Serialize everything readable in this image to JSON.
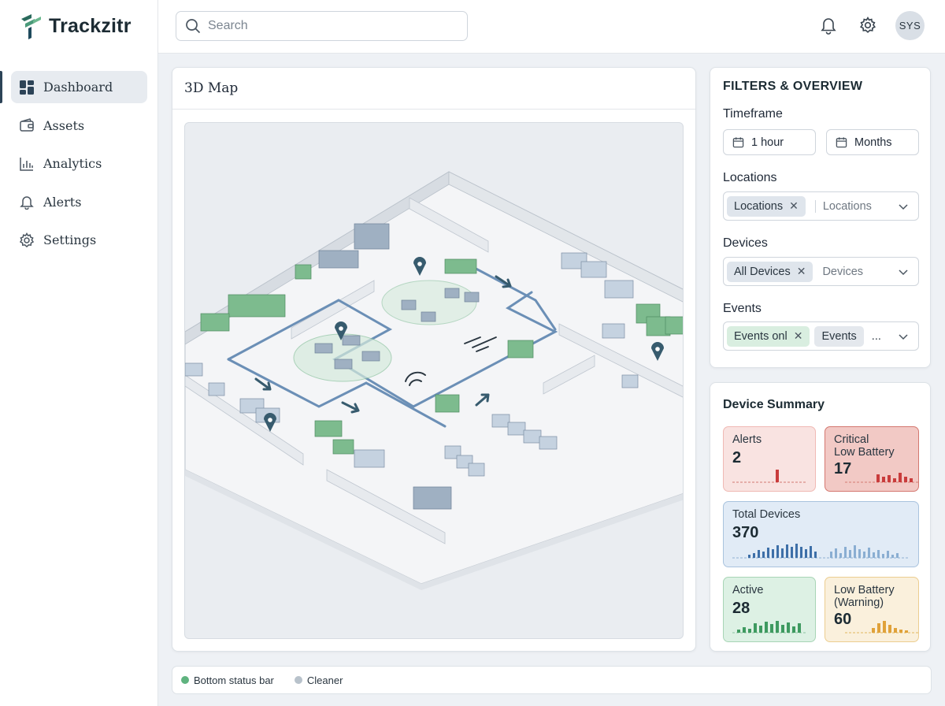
{
  "app": {
    "name": "Trackzitr"
  },
  "sidebar": {
    "items": [
      {
        "label": "Dashboard",
        "icon": "dashboard-icon",
        "active": true
      },
      {
        "label": "Assets",
        "icon": "wallet-icon",
        "active": false
      },
      {
        "label": "Analytics",
        "icon": "bar-chart-icon",
        "active": false
      },
      {
        "label": "Alerts",
        "icon": "bell-icon",
        "active": false
      },
      {
        "label": "Settings",
        "icon": "gear-icon",
        "active": false
      }
    ]
  },
  "header": {
    "search": {
      "placeholder": "Search",
      "value": ""
    },
    "avatar_initials": "SYS"
  },
  "map": {
    "title": "3D Map"
  },
  "filters": {
    "title": "FILTERS & OVERVIEW",
    "timeframe": {
      "label": "Timeframe",
      "options": [
        "1 hour",
        "Months"
      ]
    },
    "locations": {
      "label": "Locations",
      "chip": "Locations",
      "placeholder": "Locations"
    },
    "devices": {
      "label": "Devices",
      "chip": "All Devices",
      "placeholder": "Devices"
    },
    "events": {
      "label": "Events",
      "chips": [
        "Events onl",
        "Events"
      ],
      "overflow": "..."
    }
  },
  "summary": {
    "title": "Device Summary",
    "cards": {
      "alerts": {
        "label": "Alerts",
        "value": "2",
        "color": "#c93c3c"
      },
      "critical": {
        "label_line1": "Critical",
        "label_line2": "Low Battery",
        "value": "17",
        "color": "#c93c3c"
      },
      "total": {
        "label": "Total Devices",
        "value": "370",
        "color": "#3d6fa8"
      },
      "active": {
        "label": "Active",
        "value": "28",
        "color": "#3e9a60"
      },
      "warning": {
        "label_line1": "Low Battery",
        "label_line2": "(Warning)",
        "value": "60",
        "color": "#d99a2b"
      }
    }
  },
  "status_bar": {
    "items": [
      {
        "label": "Bottom status bar",
        "color": "#5fb37f"
      },
      {
        "label": "Cleaner",
        "color": "#b8c2cb"
      }
    ]
  }
}
